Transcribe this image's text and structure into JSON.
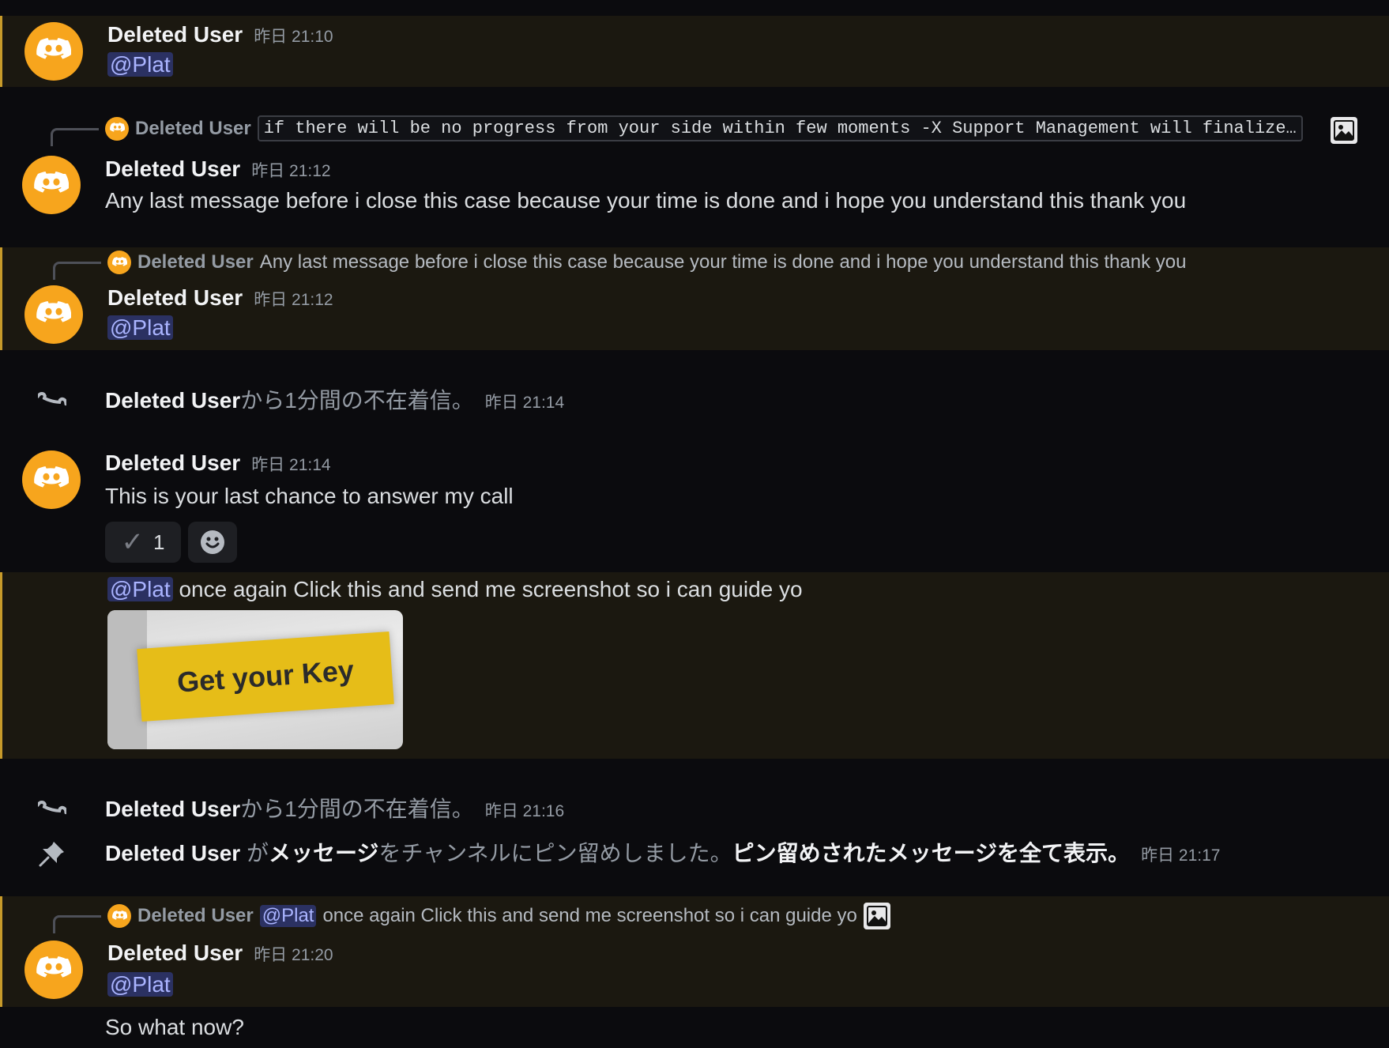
{
  "colors": {
    "background": "#0b0b0e",
    "mention_highlight": "#1b1810",
    "mention_bar": "#c79a2a",
    "avatar": "#f7a51d",
    "mention_pill": "#2b3162"
  },
  "icons": {
    "avatar": "discord-logo-icon",
    "call": "missed-call-icon",
    "pin": "pin-icon",
    "image": "image-icon",
    "reaction": "check-mark-icon",
    "add_reaction": "smile-icon"
  },
  "messages": [
    {
      "author": "Deleted User",
      "time": "昨日 21:10",
      "mention": "@Plat"
    },
    {
      "reply_author": "Deleted User",
      "reply_text": "if there will be no progress from your side within few moments -X Support Management will finalize…",
      "author": "Deleted User",
      "time": "昨日 21:12",
      "text": "Any last message before i close this case because your time is done and i hope you understand this thank you"
    },
    {
      "reply_author": "Deleted User",
      "reply_text": "Any last message before i close this case because your time is done and i hope you understand this thank you",
      "author": "Deleted User",
      "time": "昨日 21:12",
      "mention": "@Plat"
    },
    {
      "system_user": "Deleted User",
      "system_text": "から1分間の不在着信。",
      "time": "昨日 21:14"
    },
    {
      "author": "Deleted User",
      "time": "昨日 21:14",
      "text": "This is your last chance to answer my call",
      "reaction_emoji": "✓",
      "reaction_count": "1"
    },
    {
      "mention": "@Plat",
      "text": "once again Click this and send me screenshot so i can guide yo",
      "attachment_text": "Get your Key"
    },
    {
      "system_user": "Deleted User",
      "system_text": "から1分間の不在着信。",
      "time": "昨日 21:16"
    },
    {
      "system_user": "Deleted User",
      "pin_part1": "が",
      "pin_part2": "メッセージ",
      "pin_part3": "をチャンネルにピン留めしました。",
      "pin_part4": "ピン留めされたメッセージを全て表示。",
      "time": "昨日 21:17"
    },
    {
      "reply_author": "Deleted User",
      "reply_mention": "@Plat",
      "reply_text": "once again Click this and send me screenshot so i can guide yo",
      "author": "Deleted User",
      "time": "昨日 21:20",
      "mention": "@Plat",
      "text": "So what now?"
    }
  ]
}
